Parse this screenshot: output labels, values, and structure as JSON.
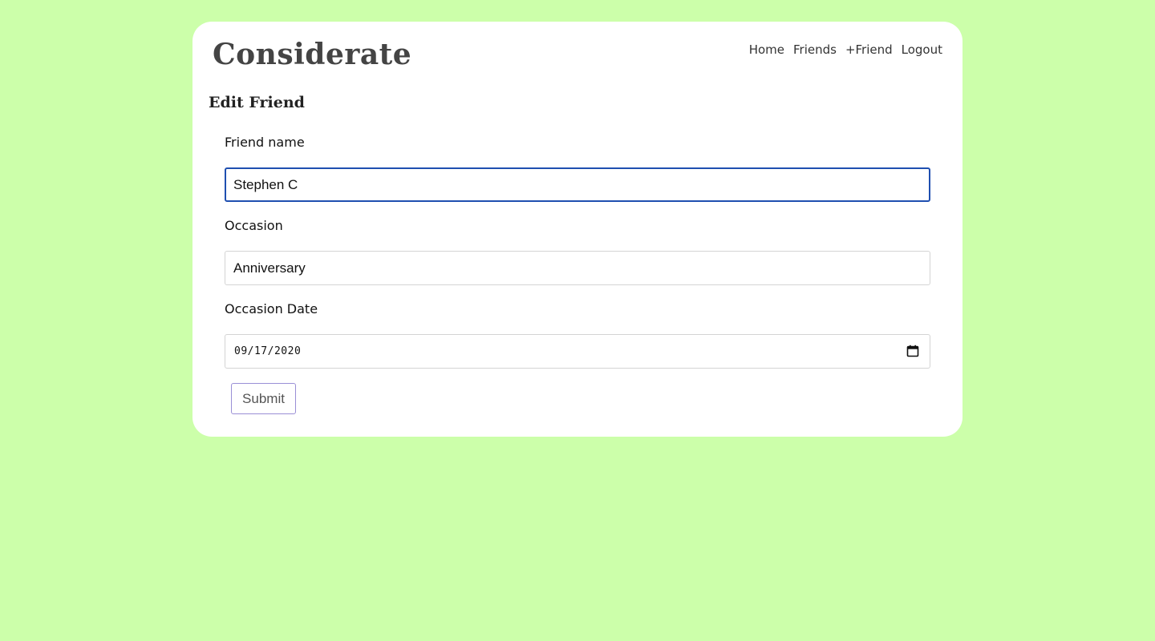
{
  "header": {
    "brand": "Considerate",
    "nav": {
      "home": "Home",
      "friends": "Friends",
      "add_friend": "+Friend",
      "logout": "Logout"
    }
  },
  "form": {
    "title": "Edit Friend",
    "friend_name": {
      "label": "Friend name",
      "value": "Stephen C"
    },
    "occasion": {
      "label": "Occasion",
      "value": "Anniversary"
    },
    "occasion_date": {
      "label": "Occasion Date",
      "value": "09/17/2020"
    },
    "submit_label": "Submit"
  },
  "colors": {
    "background": "#ccffaa",
    "card": "#ffffff",
    "focus_border": "#1f4fb0",
    "submit_border": "#9a8fd6"
  }
}
